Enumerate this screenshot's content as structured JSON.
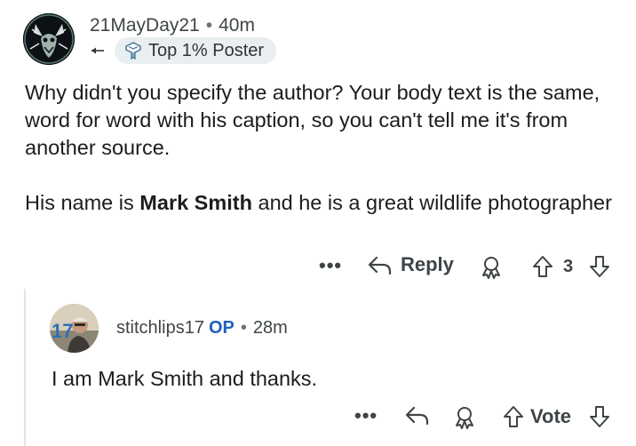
{
  "comment": {
    "username": "21MayDay21",
    "separator": "•",
    "time": "40m",
    "badge": {
      "icon": "achievement-badge-icon",
      "label": "Top 1% Poster"
    },
    "paragraph_1": "Why didn't you specify the author? Your body text is the same, word for word with his caption, so you can't tell me it's from another source.",
    "paragraph_2_before": "His name is ",
    "paragraph_2_bold": "Mark Smith",
    "paragraph_2_after": " and he is a great wildlife photographer",
    "actions": {
      "more": "•••",
      "reply_label": "Reply",
      "vote_count": "3"
    }
  },
  "reply": {
    "username": "stitchlips17",
    "op_tag": "OP",
    "separator": "•",
    "time": "28m",
    "avatar_number": "17",
    "text": "I am Mark Smith and thanks.",
    "actions": {
      "more": "•••",
      "vote_label": "Vote"
    }
  },
  "colors": {
    "text": "#1c1c1c",
    "meta": "#3e4447",
    "op": "#1f5fbf",
    "badge_bg": "#e9eef1",
    "thread_line": "#e1e4e6"
  }
}
